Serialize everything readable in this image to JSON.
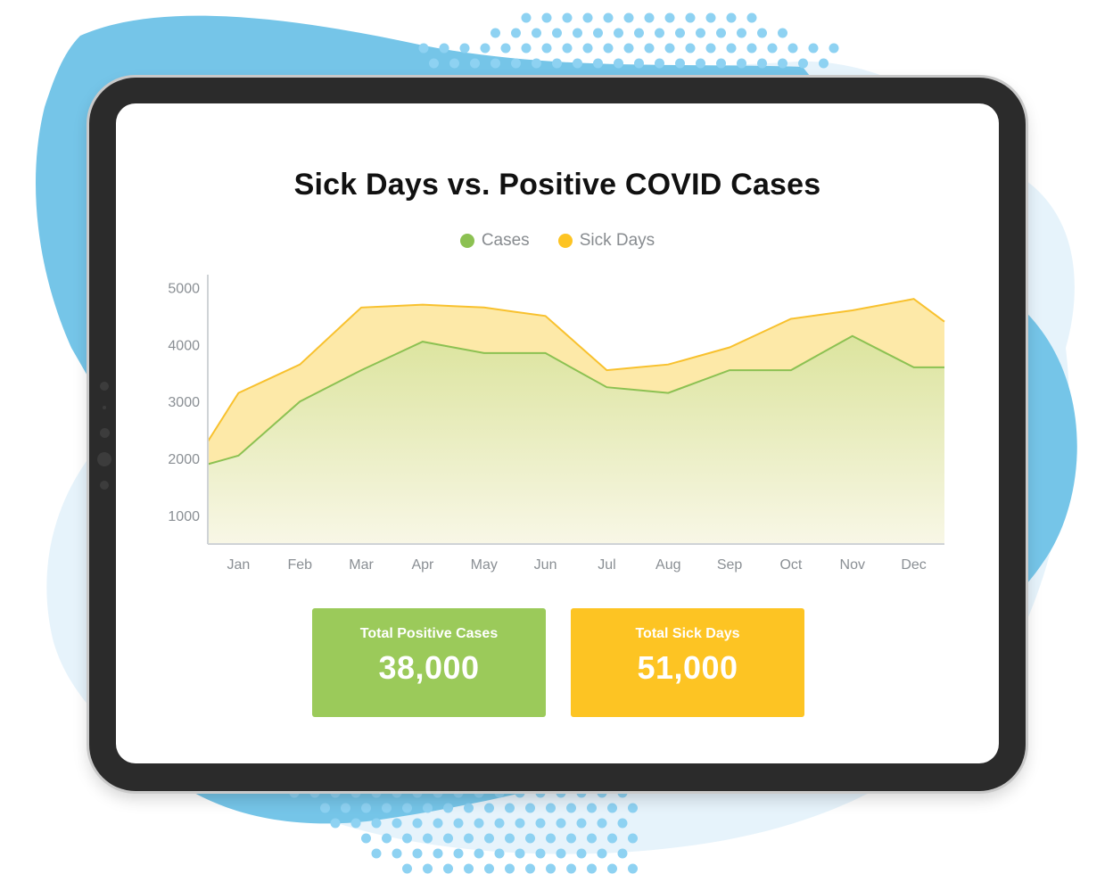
{
  "chart_data": {
    "type": "area",
    "title": "Sick Days vs. Positive COVID Cases",
    "xlabel": "",
    "ylabel": "",
    "categories": [
      "Jan",
      "Feb",
      "Mar",
      "Apr",
      "May",
      "Jun",
      "Jul",
      "Aug",
      "Sep",
      "Oct",
      "Nov",
      "Dec"
    ],
    "yticks": [
      1000,
      2000,
      3000,
      4000,
      5000
    ],
    "ylim": [
      500,
      5100
    ],
    "grid": false,
    "legend_position": "top-center",
    "series": [
      {
        "name": "Cases",
        "color": "#8cc152",
        "x": [
          "",
          "Jan",
          "",
          "Feb",
          "",
          "Mar",
          "",
          "Apr",
          "",
          "May",
          "",
          "Jun",
          "",
          "Jul",
          "",
          "Aug",
          "",
          "Sep",
          "",
          "Oct",
          "",
          "Nov",
          "",
          "Dec",
          ""
        ],
        "values": [
          1900,
          2050,
          2525,
          3000,
          3275,
          3550,
          3800,
          4050,
          3950,
          3850,
          3850,
          3850,
          3550,
          3250,
          3200,
          3150,
          3350,
          3550,
          3550,
          3550,
          3850,
          4150,
          3875,
          3600,
          3600
        ]
      },
      {
        "name": "Sick Days",
        "color": "#f8c12e",
        "x": [
          "",
          "Jan",
          "",
          "Feb",
          "",
          "Mar",
          "",
          "Apr",
          "",
          "May",
          "",
          "Jun",
          "",
          "Jul",
          "",
          "Aug",
          "",
          "Sep",
          "",
          "Oct",
          "",
          "Nov",
          "",
          "Dec",
          ""
        ],
        "values": [
          2300,
          3150,
          3400,
          3650,
          4150,
          4650,
          4675,
          4700,
          4675,
          4650,
          4575,
          4500,
          4025,
          3550,
          3600,
          3650,
          3800,
          3950,
          4200,
          4450,
          4525,
          4600,
          4700,
          4800,
          4400
        ]
      }
    ]
  },
  "summary": {
    "cases_label": "Total Positive Cases",
    "cases_value": "38,000",
    "sick_label": "Total Sick Days",
    "sick_value": "51,000"
  }
}
